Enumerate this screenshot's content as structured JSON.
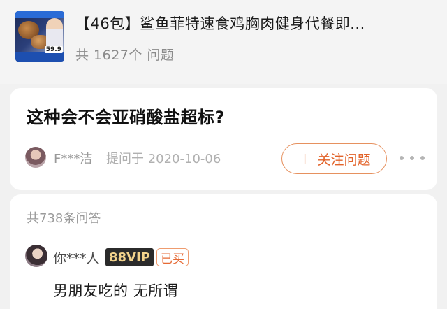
{
  "product": {
    "title": "【46包】鲨鱼菲特速食鸡胸肉健身代餐即...",
    "question_count": "共 1627个 问题",
    "thumbnail_price": "59.9"
  },
  "question": {
    "title": "这种会不会亚硝酸盐超标?",
    "asker_name": "F***洁",
    "ask_meta": "提问于 2020-10-06",
    "follow_label": "关注问题"
  },
  "answers": {
    "count_label": "共738条问答",
    "items": [
      {
        "user": "你***人",
        "vip_badge": "88VIP",
        "bought_badge": "已买",
        "text": "男朋友吃的 无所谓"
      }
    ]
  },
  "colors": {
    "accent": "#e2632a",
    "background": "#f1f1f1",
    "card": "#ffffff",
    "vip_bg": "#2b2b2b",
    "vip_text": "#f3d38c"
  },
  "icons": [
    "plus-icon",
    "more-icon"
  ]
}
